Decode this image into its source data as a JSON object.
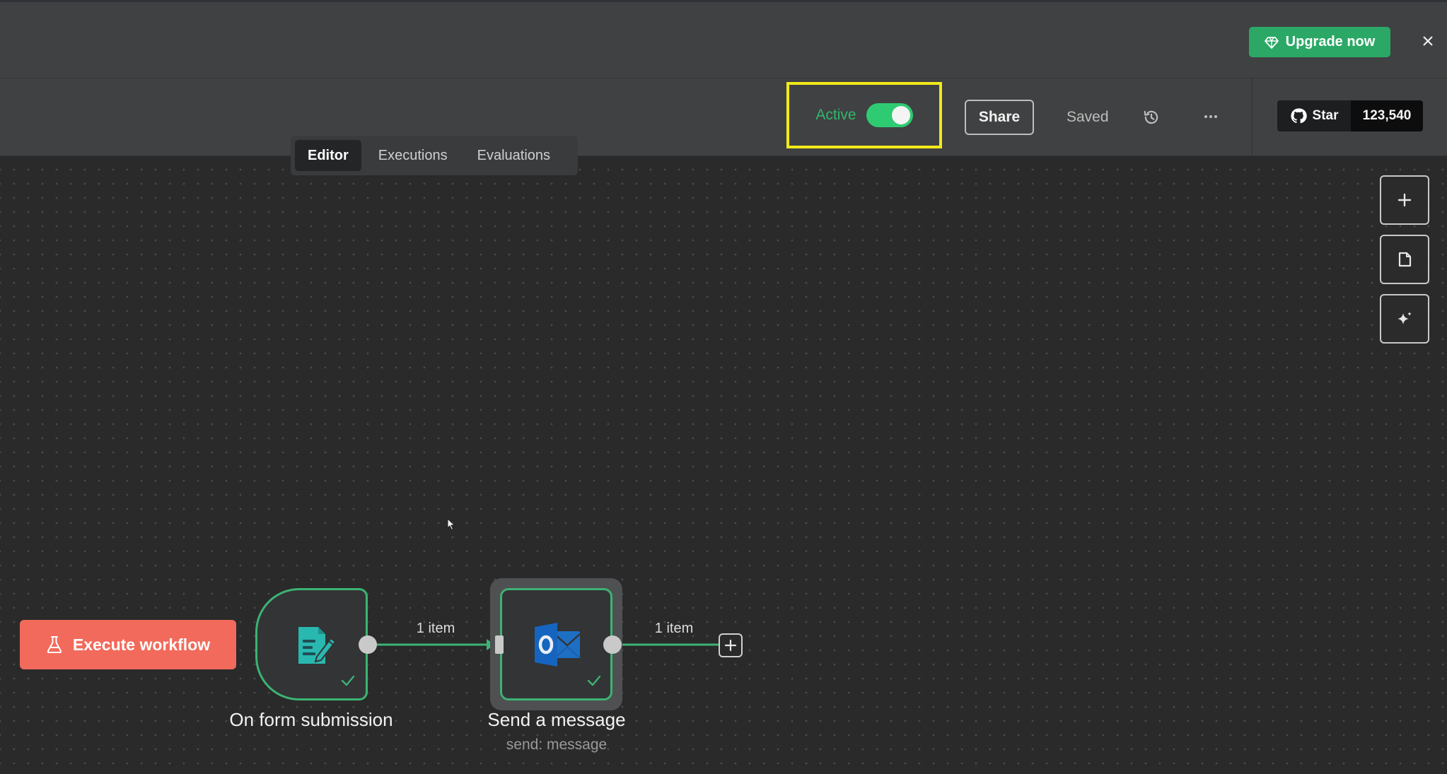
{
  "banner": {
    "upgrade_label": "Upgrade now",
    "close_icon": "close-icon",
    "upgrade_color": "#2ba866"
  },
  "header": {
    "active_label": "Active",
    "active_state": true,
    "share_label": "Share",
    "saved_label": "Saved",
    "github": {
      "star_label": "Star",
      "star_count": "123,540"
    },
    "highlight_color": "#f2ea1a"
  },
  "tabs": [
    {
      "label": "Editor",
      "active": true
    },
    {
      "label": "Executions",
      "active": false
    },
    {
      "label": "Evaluations",
      "active": false
    }
  ],
  "canvas_controls": [
    {
      "icon": "plus-icon"
    },
    {
      "icon": "sticky-note-icon"
    },
    {
      "icon": "sparkle-icon"
    }
  ],
  "execute": {
    "label": "Execute workflow",
    "color": "#f26a5b"
  },
  "nodes": [
    {
      "title": "On form submission",
      "subtitle": "",
      "icon": "form-icon",
      "status": "success"
    },
    {
      "title": "Send a message",
      "subtitle": "send: message",
      "icon": "outlook-icon",
      "status": "success"
    }
  ],
  "connections": [
    {
      "label": "1 item"
    },
    {
      "label": "1 item"
    }
  ],
  "accent_green": "#3cb374"
}
